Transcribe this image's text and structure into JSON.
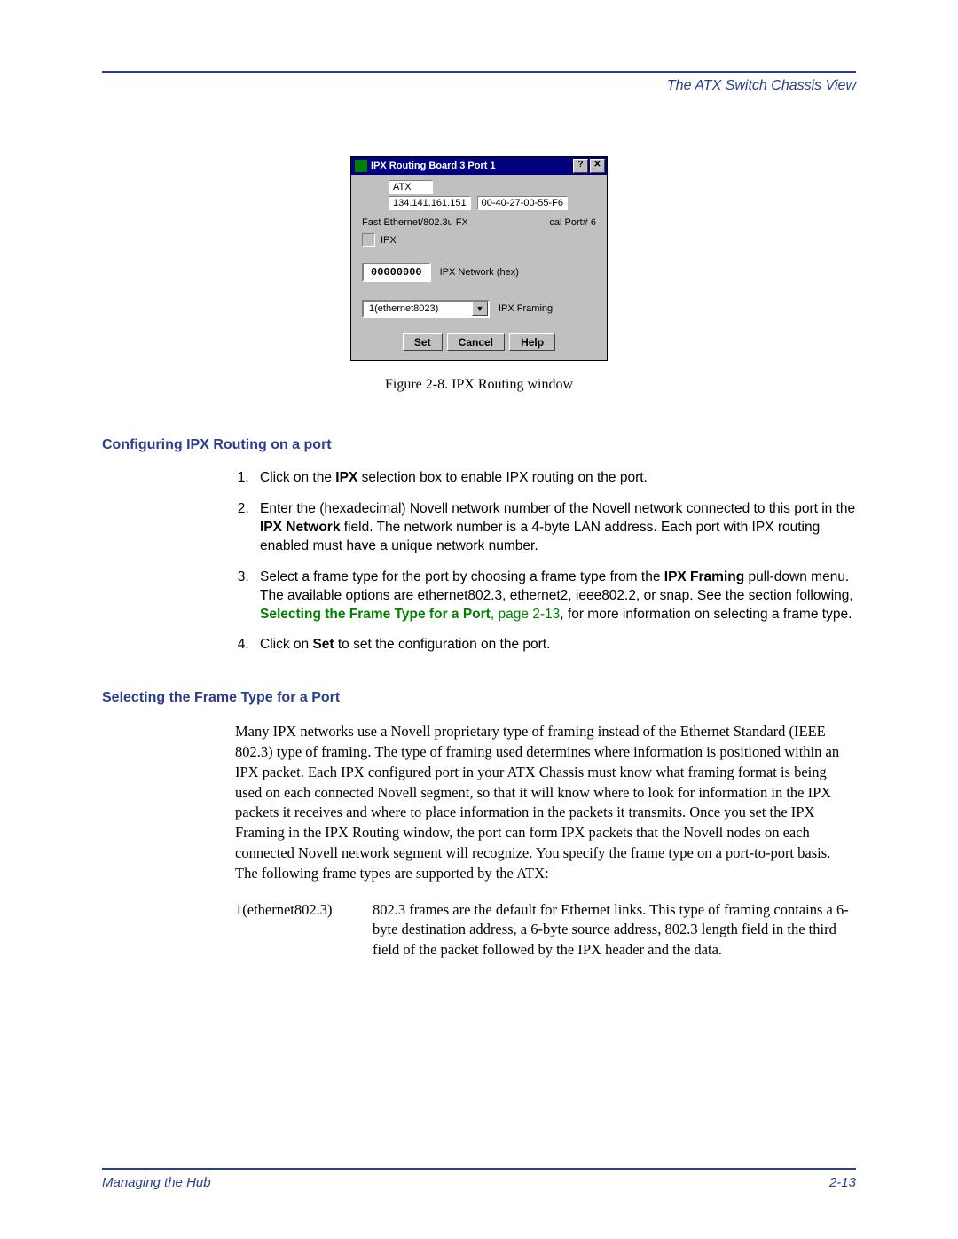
{
  "header": {
    "title": "The ATX Switch Chassis View"
  },
  "dialog": {
    "title": "IPX Routing Board 3 Port 1",
    "help_btn": "?",
    "close_btn": "✕",
    "device_name": "ATX",
    "ip_address": "134.141.161.151",
    "mac_address": "00-40-27-00-55-F6",
    "media_type": "Fast Ethernet/802.3u FX",
    "port_label": "cal Port#  6",
    "ipx_checkbox_label": "IPX",
    "ipx_network_value": "00000000",
    "ipx_network_label": "IPX Network (hex)",
    "ipx_framing_value": "1(ethernet8023)",
    "ipx_framing_label": "IPX Framing",
    "set_btn": "Set",
    "cancel_btn": "Cancel",
    "help_button": "Help"
  },
  "figure_caption": "Figure 2-8. IPX Routing window",
  "section1": {
    "heading": "Configuring IPX Routing on a port",
    "steps": {
      "s1_a": "Click on the ",
      "s1_b": "IPX",
      "s1_c": " selection box to enable IPX routing on the port.",
      "s2_a": "Enter the (hexadecimal) Novell network number of the Novell network connected to this port in the ",
      "s2_b": "IPX Network",
      "s2_c": " field. The network number is a 4-byte LAN address. Each port with IPX routing enabled must have a unique network number.",
      "s3_a": "Select a frame type for the port by choosing a frame type from the ",
      "s3_b": "IPX Framing",
      "s3_c": " pull-down menu. The available options are ethernet802.3, ethernet2, ieee802.2, or snap. See the section following, ",
      "s3_link": "Selecting the Frame Type for a Port",
      "s3_ref": ", page 2-13",
      "s3_d": ", for more information on selecting a frame type.",
      "s4_a": "Click on ",
      "s4_b": "Set",
      "s4_c": " to set the configuration on the port."
    }
  },
  "section2": {
    "heading": "Selecting the Frame Type for a Port",
    "paragraph": "Many IPX networks use a Novell proprietary type of framing instead of the Ethernet Standard (IEEE 802.3) type of framing. The type of framing used determines where information is positioned within an IPX packet. Each IPX configured port in your ATX Chassis must know what framing format is being used on each connected Novell segment, so that it will know where to look for information in the IPX packets it receives and where to place information in the packets it transmits. Once you set the IPX Framing in the IPX Routing window, the port can form IPX packets that the Novell nodes on each connected Novell network segment will recognize. You specify the frame type on a port-to-port basis. The following frame types are supported by the ATX:",
    "def_term": "1(ethernet802.3)",
    "def_desc": "802.3 frames are the default for Ethernet links. This type of framing contains a 6-byte destination address, a 6-byte source address, 802.3 length field in the third field of the packet followed by the IPX header and the data."
  },
  "footer": {
    "left": "Managing the Hub",
    "right": "2-13"
  }
}
